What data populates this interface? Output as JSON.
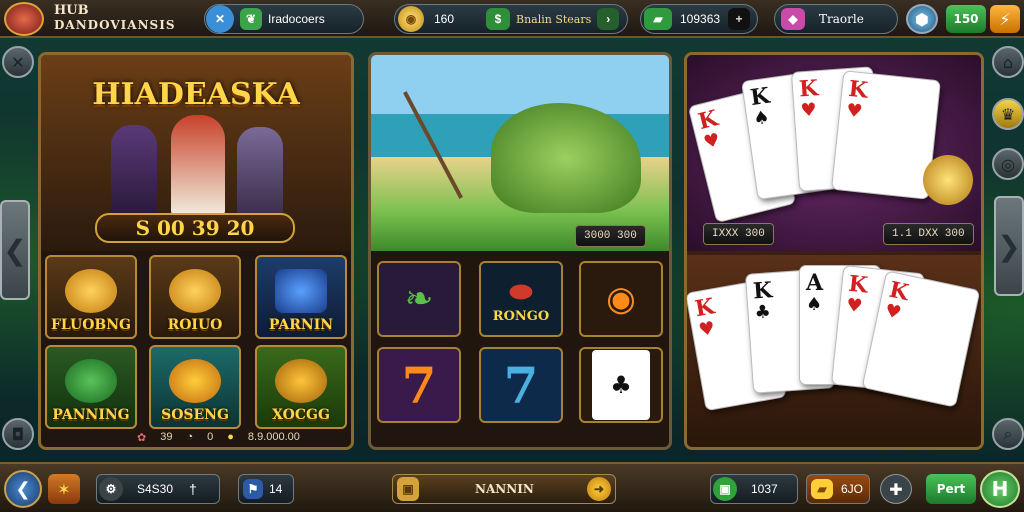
{
  "header": {
    "brand_line1": "HUB",
    "brand_line2": "DANDOVIANSIS",
    "tabs_label": "Iradocoers",
    "coins_value": "160",
    "status_label": "Bnalin Stears",
    "gems_value": "109363",
    "tropy_label": "Traorle",
    "currency_value": "150"
  },
  "panels": {
    "left": {
      "title": "HIADEASKA",
      "jackpot": "S 00 39 20",
      "tiles": [
        "FLUOBNG",
        "ROIUO",
        "PARNIN",
        "PANNING",
        "SOSENG",
        "XOCGG"
      ],
      "footer": [
        "39",
        "0",
        "8.9.000.00"
      ]
    },
    "middle": {
      "scene_value": "3000 300",
      "slot_labels": [
        "",
        "RONGO",
        "",
        "",
        "",
        ""
      ]
    },
    "right": {
      "top_plates": [
        "IXXX 300",
        "1.1 DXX 300"
      ]
    }
  },
  "footer": {
    "left_value": "S4S30",
    "mid_value": "14",
    "center_label": "NANNIN",
    "right_value": "1037",
    "gold_value": "6JO",
    "play_label": "Pert"
  },
  "colors": {
    "accent_gold": "#ffd64a",
    "frame": "#8a6a2e",
    "green_btn": "#2fa339"
  }
}
